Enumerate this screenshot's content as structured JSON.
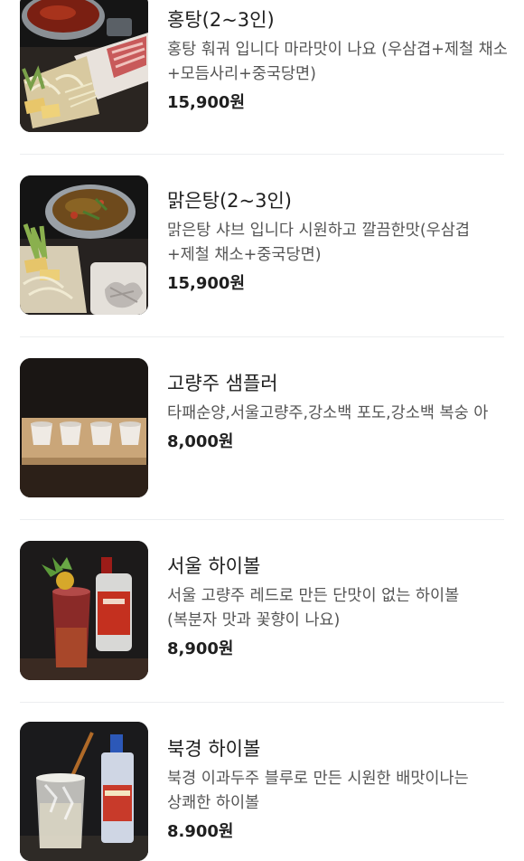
{
  "menu": {
    "items": [
      {
        "name": "홍탕(2~3인)",
        "description": "홍탕 훠궈 입니다 마라맛이 나요 (우삼겹+제철 채소+모듬사리+중국당면)",
        "price": "15,900원",
        "photo": "hotpot-red-photo"
      },
      {
        "name": "맑은탕(2~3인)",
        "description": "맑은탕 샤브 입니다 시원하고 깔끔한맛(우삼겹 +제철 채소+중국당면)",
        "price": "15,900원",
        "photo": "hotpot-clear-photo"
      },
      {
        "name": "고량주 샘플러",
        "description": "타패순양,서울고량주,강소백 포도,강소백 복숭 아",
        "price": "8,000원",
        "photo": "sampler-cups-photo"
      },
      {
        "name": "서울 하이볼",
        "description": "서울 고량주 레드로 만든 단맛이 없는 하이볼 (복분자 맛과 꽃향이 나요)",
        "price": "8,900원",
        "photo": "seoul-highball-photo"
      },
      {
        "name": "북경 하이볼",
        "description": "북경 이과두주 블루로 만든 시원한 배맛이나는 상쾌한 하이볼",
        "price": "8.900원",
        "photo": "beijing-highball-photo"
      }
    ]
  }
}
